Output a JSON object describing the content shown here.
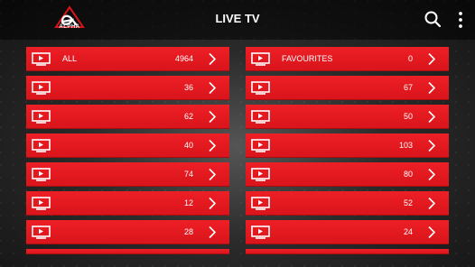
{
  "header": {
    "logo_text": "ALPHA",
    "title": "LIVE TV"
  },
  "left_rows": [
    {
      "name": "ALL",
      "count": "4964"
    },
    {
      "name": "",
      "count": "36"
    },
    {
      "name": "",
      "count": "62"
    },
    {
      "name": "",
      "count": "40"
    },
    {
      "name": "",
      "count": "74"
    },
    {
      "name": "",
      "count": "12"
    },
    {
      "name": "",
      "count": "28"
    }
  ],
  "right_rows": [
    {
      "name": "FAVOURITES",
      "count": "0"
    },
    {
      "name": "",
      "count": "67"
    },
    {
      "name": "",
      "count": "50"
    },
    {
      "name": "",
      "count": "103"
    },
    {
      "name": "",
      "count": "80"
    },
    {
      "name": "",
      "count": "52"
    },
    {
      "name": "",
      "count": "24"
    }
  ],
  "colors": {
    "row_red": "#e0171d",
    "text": "#ffffff"
  },
  "icons": {
    "row_icon": "tv-play-icon",
    "row_arrow": "chevron-right-icon",
    "search": "search-icon",
    "menu": "more-vertical-icon"
  }
}
